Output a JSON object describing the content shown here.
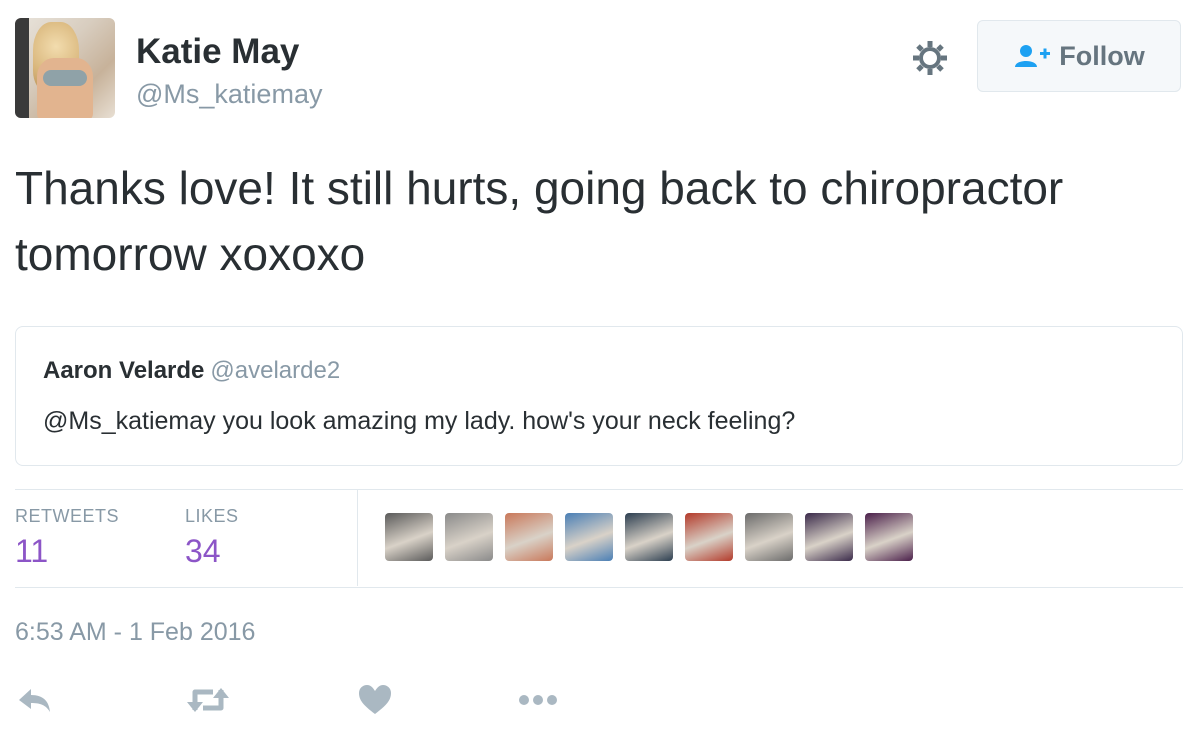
{
  "author": {
    "name": "Katie May",
    "handle": "@Ms_katiemay"
  },
  "header": {
    "follow_label": "Follow",
    "settings_icon": "gear-icon",
    "follow_icon": "follow-user-icon"
  },
  "tweet": {
    "text": "Thanks love! It still hurts, going back to chiropractor tomorrow xoxoxo"
  },
  "quoted": {
    "name": "Aaron Velarde",
    "handle": "@avelarde2",
    "text": "@Ms_katiemay you look amazing my lady. how's your neck feeling?"
  },
  "stats": {
    "retweets_label": "RETWEETS",
    "retweets_count": "11",
    "likes_label": "LIKES",
    "likes_count": "34"
  },
  "likers": {
    "count": 9,
    "colors": [
      "#5a5a5a",
      "#8a8a8a",
      "#c9785a",
      "#4a7fb5",
      "#2c3e50",
      "#b33a2a",
      "#6b6b6b",
      "#3a2a4a",
      "#4a1f4a"
    ]
  },
  "timestamp": "6:53 AM - 1 Feb 2016",
  "actions": [
    "reply-icon",
    "retweet-icon",
    "like-icon",
    "more-icon"
  ],
  "colors": {
    "accent_purple": "#8c55c7",
    "muted": "#8899a6",
    "text": "#292f33",
    "link_blue": "#1da1f2"
  }
}
